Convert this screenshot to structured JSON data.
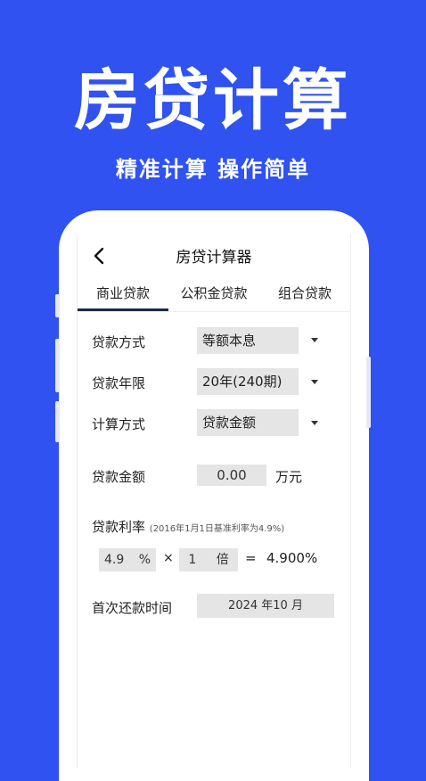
{
  "hero": {
    "title": "房贷计算",
    "subtitle": "精准计算 操作简单"
  },
  "nav": {
    "back_icon": "chevron-left-icon",
    "title": "房贷计算器"
  },
  "tabs": [
    {
      "label": "商业贷款",
      "active": true
    },
    {
      "label": "公积金贷款",
      "active": false
    },
    {
      "label": "组合贷款",
      "active": false
    }
  ],
  "form": {
    "repay_method": {
      "label": "贷款方式",
      "value": "等额本息"
    },
    "loan_term": {
      "label": "贷款年限",
      "value": "20年(240期)"
    },
    "calc_method": {
      "label": "计算方式",
      "value": "贷款金额"
    },
    "loan_amount": {
      "label": "贷款金额",
      "value": "0.00",
      "unit": "万元"
    },
    "rate": {
      "label": "贷款利率",
      "note": "(2016年1月1日基准利率为4.9%)",
      "base_value": "4.9",
      "base_unit": "%",
      "times_symbol": "×",
      "multiplier_value": "1",
      "multiplier_unit": "倍",
      "equals_symbol": "=",
      "result": "4.900%"
    },
    "first_payment": {
      "label": "首次还款时间",
      "value": "2024 年10 月"
    }
  },
  "colors": {
    "background": "#2f52f0",
    "field_bg": "#e5e5e5",
    "tab_indicator": "#1c2a4a"
  }
}
